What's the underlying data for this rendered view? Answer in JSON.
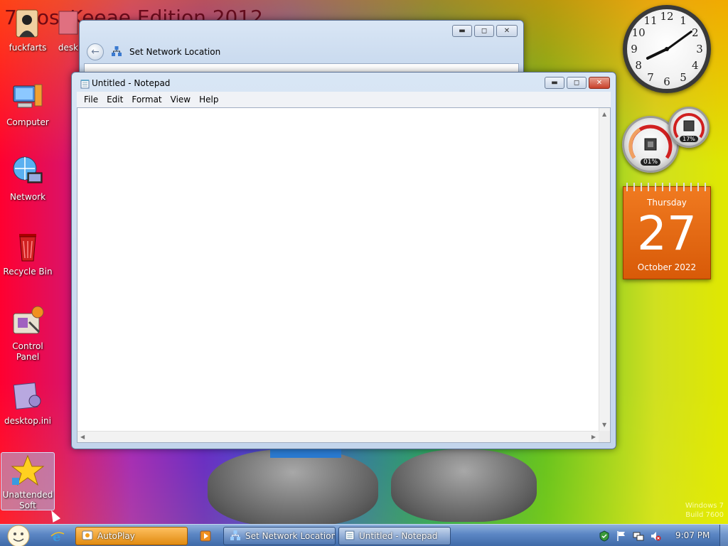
{
  "desktop": {
    "headline": "7 BossKeeae Edition 2012",
    "icons": [
      {
        "label": "fuckfarts"
      },
      {
        "label": "desk"
      },
      {
        "label": "Computer"
      },
      {
        "label": "Network"
      },
      {
        "label": "Recycle Bin"
      },
      {
        "label": "Control Panel"
      },
      {
        "label": "desktop.ini"
      },
      {
        "label": "Unattended Soft"
      }
    ],
    "watermark_line1": "Windows 7",
    "watermark_line2": "Build 7600"
  },
  "network_window": {
    "title": "Set Network Location"
  },
  "notepad": {
    "title": "Untitled - Notepad",
    "menu": [
      "File",
      "Edit",
      "Format",
      "View",
      "Help"
    ],
    "content": ""
  },
  "gadgets": {
    "clock": {
      "hour": 8,
      "minute": 9,
      "numbers": [
        "12",
        "1",
        "2",
        "3",
        "4",
        "5",
        "6",
        "7",
        "8",
        "9",
        "10",
        "11"
      ]
    },
    "cpu_meter": {
      "cpu": "01%",
      "memory": "17%"
    },
    "calendar": {
      "weekday": "Thursday",
      "day": "27",
      "month_year": "October 2022"
    }
  },
  "taskbar": {
    "buttons": [
      {
        "label": "AutoPlay"
      },
      {
        "label": "Set Network Location"
      },
      {
        "label": "Untitled - Notepad"
      }
    ],
    "time": "9:07 PM"
  },
  "colors": {
    "taskbar": "#5b86c4",
    "calendar": "#e86a10",
    "autoplay": "#f0a030"
  }
}
